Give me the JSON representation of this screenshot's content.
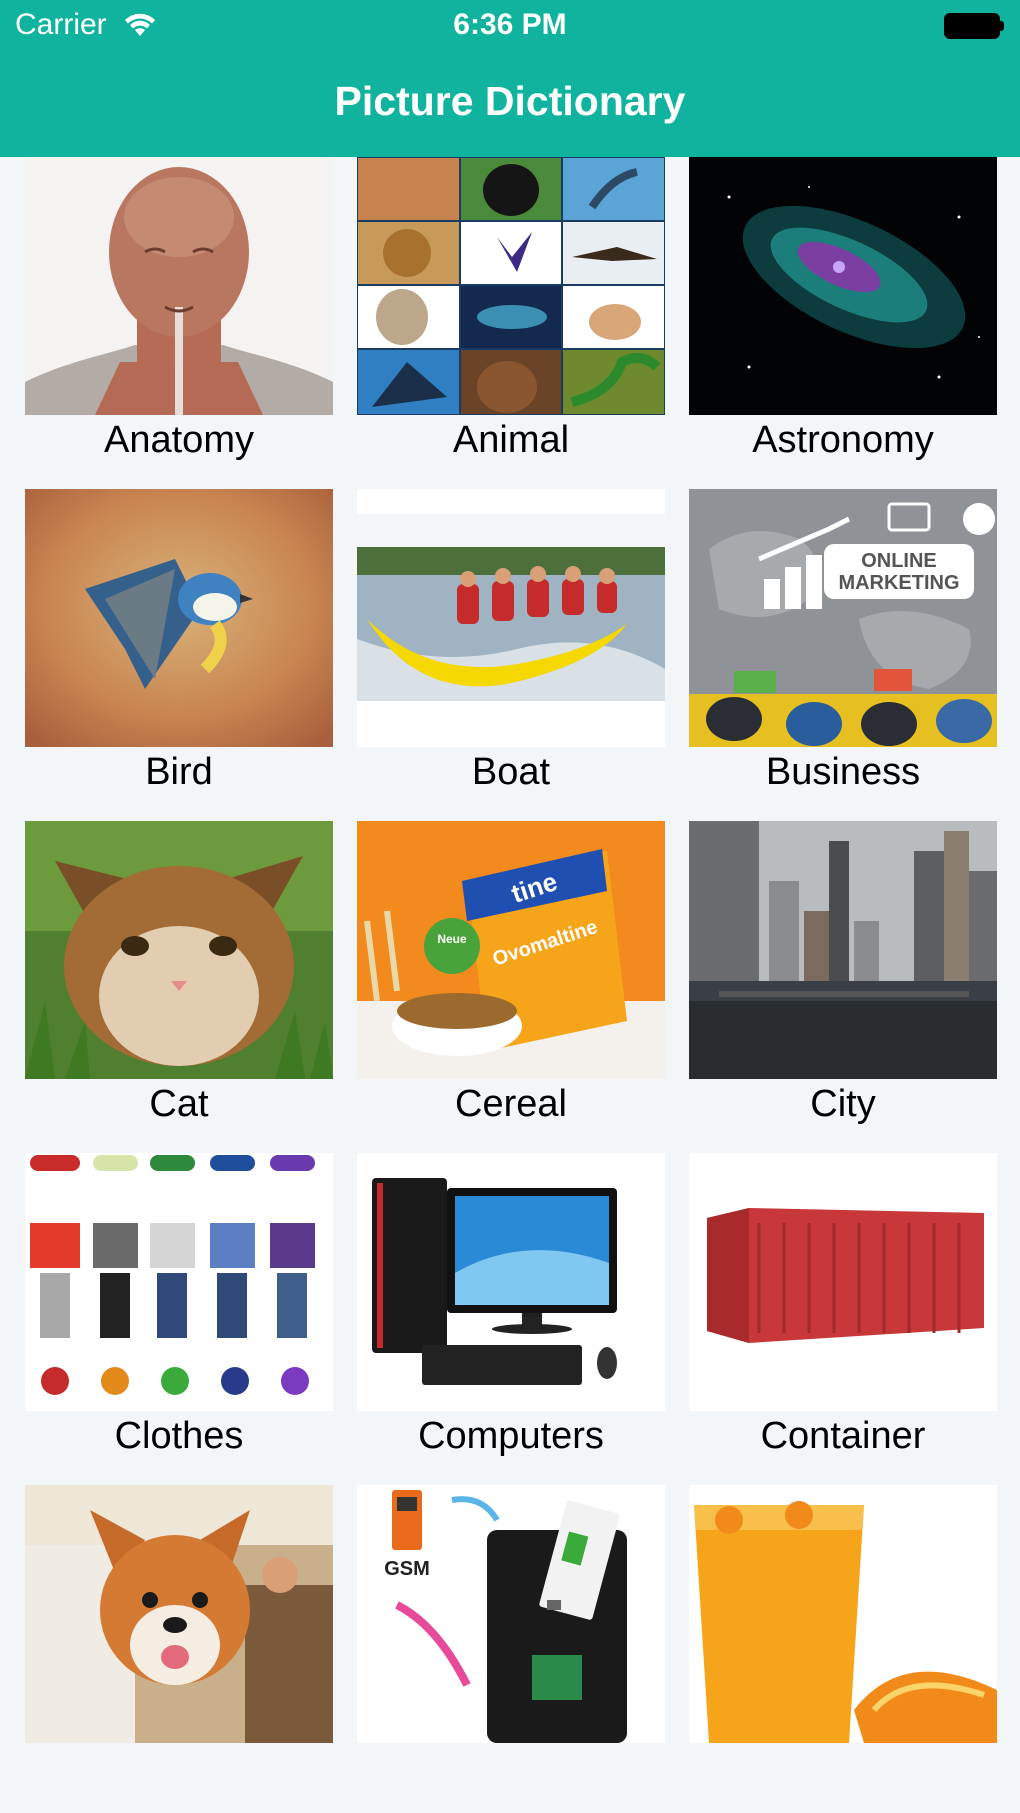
{
  "status_bar": {
    "carrier": "Carrier",
    "time": "6:36 PM"
  },
  "nav": {
    "title": "Picture Dictionary"
  },
  "categories": [
    {
      "label": "Anatomy",
      "icon": "anatomy-image"
    },
    {
      "label": "Animal",
      "icon": "animal-collage-image"
    },
    {
      "label": "Astronomy",
      "icon": "galaxy-image"
    },
    {
      "label": "Bird",
      "icon": "bird-image"
    },
    {
      "label": "Boat",
      "icon": "banana-boat-image"
    },
    {
      "label": "Business",
      "icon": "online-marketing-image",
      "image_text": "ONLINE MARKETING"
    },
    {
      "label": "Cat",
      "icon": "kitten-image"
    },
    {
      "label": "Cereal",
      "icon": "cereal-box-image",
      "image_text": "Ovomaltine"
    },
    {
      "label": "City",
      "icon": "city-skyline-image"
    },
    {
      "label": "Clothes",
      "icon": "clothes-image"
    },
    {
      "label": "Computers",
      "icon": "desktop-computer-image"
    },
    {
      "label": "Container",
      "icon": "shipping-container-image"
    },
    {
      "label": "",
      "icon": "puppy-image"
    },
    {
      "label": "",
      "icon": "gsm-device-image",
      "image_text": "GSM"
    },
    {
      "label": "",
      "icon": "orange-juice-image"
    }
  ],
  "colors": {
    "header": "#10b39e",
    "background": "#f3f6f9"
  }
}
